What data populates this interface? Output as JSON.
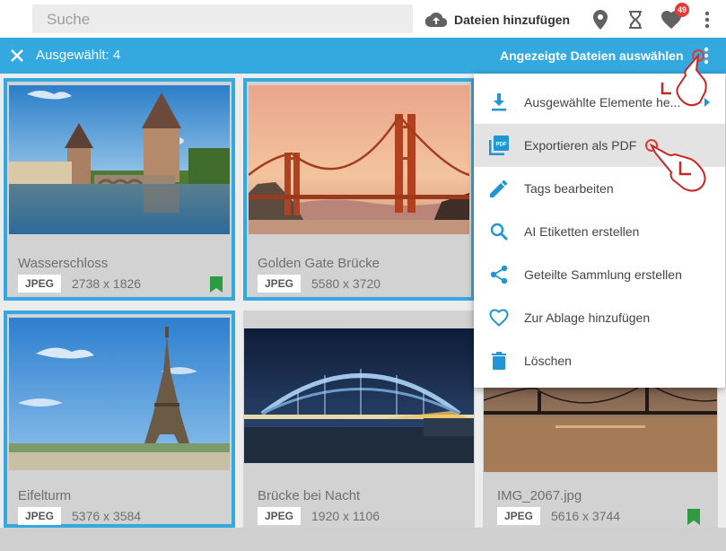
{
  "header": {
    "search_placeholder": "Suche",
    "upload_label": "Dateien hinzufügen",
    "favorites_count": "49"
  },
  "selection_bar": {
    "count_label": "Ausgewählt: 4",
    "select_displayed_label": "Angezeigte Dateien auswählen"
  },
  "menu": {
    "items": [
      {
        "label": "Ausgewählte Elemente he...",
        "icon": "download-icon"
      },
      {
        "label": "Exportieren als PDF",
        "icon": "pdf-icon"
      },
      {
        "label": "Tags bearbeiten",
        "icon": "pencil-icon"
      },
      {
        "label": "AI Etiketten erstellen",
        "icon": "search-icon"
      },
      {
        "label": "Geteilte Sammlung erstellen",
        "icon": "share-icon"
      },
      {
        "label": "Zur Ablage hinzufügen",
        "icon": "heart-icon"
      },
      {
        "label": "Löschen",
        "icon": "trash-icon"
      }
    ]
  },
  "cards": [
    {
      "title": "Wasserschloss",
      "format": "JPEG",
      "dims": "2738 x 1826",
      "selected": true,
      "bookmarked": true
    },
    {
      "title": "Golden Gate Brücke",
      "format": "JPEG",
      "dims": "5580 x 3720",
      "selected": true,
      "bookmarked": false
    },
    {
      "title": "Eifelturm",
      "format": "JPEG",
      "dims": "5376 x 3584",
      "selected": true,
      "bookmarked": false
    },
    {
      "title": "Brücke bei Nacht",
      "format": "JPEG",
      "dims": "1920 x 1106",
      "selected": false,
      "bookmarked": false
    },
    {
      "title": "IMG_2067.jpg",
      "format": "JPEG",
      "dims": "5616 x 3744",
      "selected": false,
      "bookmarked": true
    }
  ],
  "colors": {
    "accent": "#33a9e0",
    "badge": "#e53935",
    "bookmark": "#2e9b43",
    "menu_icon": "#2196d3"
  }
}
